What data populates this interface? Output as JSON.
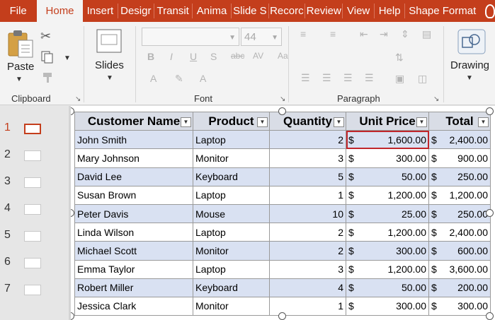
{
  "tabs": [
    "File",
    "Home",
    "Insert",
    "Design",
    "Transitions",
    "Animations",
    "Slide Show",
    "Record",
    "Review",
    "View",
    "Help",
    "Shape Format"
  ],
  "tab_display": [
    "File",
    "Home",
    "Insert",
    "Desigr",
    "Transit",
    "Anima",
    "Slide S",
    "Recorc",
    "Review",
    "View",
    "Help",
    "Shape Format"
  ],
  "active_tab": "Home",
  "ribbon": {
    "clipboard": {
      "paste_label": "Paste",
      "group_label": "Clipboard"
    },
    "slides": {
      "label": "Slides"
    },
    "font": {
      "font_size": "44",
      "group_label": "Font"
    },
    "paragraph": {
      "group_label": "Paragraph"
    },
    "drawing": {
      "label": "Drawing"
    }
  },
  "slides": [
    "1",
    "2",
    "3",
    "4",
    "5",
    "6",
    "7"
  ],
  "active_slide": "1",
  "table": {
    "headers": [
      "Customer Name",
      "Product",
      "Quantity",
      "Unit Price",
      "Total"
    ],
    "rows": [
      [
        "John Smith",
        "Laptop",
        "2",
        "$",
        "1,600.00",
        "$",
        "2,400.00"
      ],
      [
        "Mary Johnson",
        "Monitor",
        "3",
        "$",
        "300.00",
        "$",
        "900.00"
      ],
      [
        "David Lee",
        "Keyboard",
        "5",
        "$",
        "50.00",
        "$",
        "250.00"
      ],
      [
        "Susan Brown",
        "Laptop",
        "1",
        "$",
        "1,200.00",
        "$",
        "1,200.00"
      ],
      [
        "Peter Davis",
        "Mouse",
        "10",
        "$",
        "25.00",
        "$",
        "250.00"
      ],
      [
        "Linda Wilson",
        "Laptop",
        "2",
        "$",
        "1,200.00",
        "$",
        "2,400.00"
      ],
      [
        "Michael Scott",
        "Monitor",
        "2",
        "$",
        "300.00",
        "$",
        "600.00"
      ],
      [
        "Emma Taylor",
        "Laptop",
        "3",
        "$",
        "1,200.00",
        "$",
        "3,600.00"
      ],
      [
        "Robert Miller",
        "Keyboard",
        "4",
        "$",
        "50.00",
        "$",
        "200.00"
      ],
      [
        "Jessica Clark",
        "Monitor",
        "1",
        "$",
        "300.00",
        "$",
        "300.00"
      ]
    ]
  },
  "colors": {
    "accent": "#c43e1c",
    "band": "#d9e1f2",
    "selection": "#c0262c"
  }
}
